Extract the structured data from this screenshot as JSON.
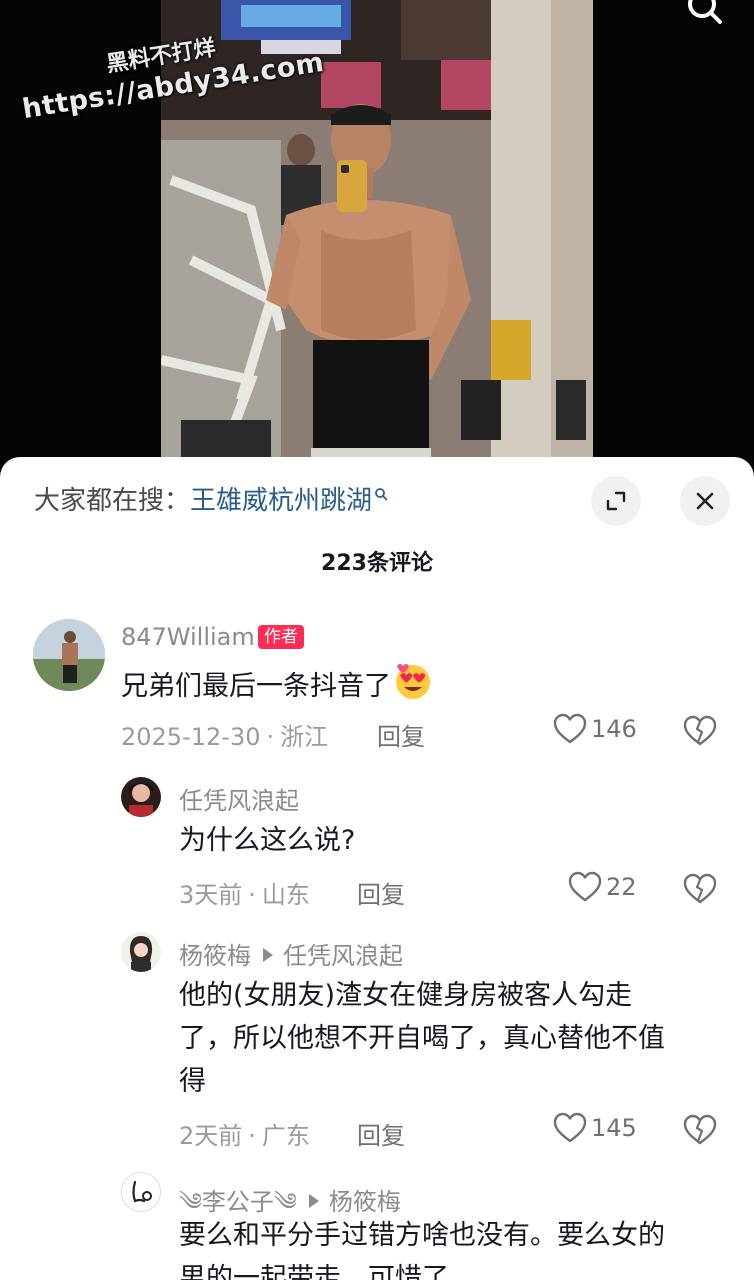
{
  "watermark": {
    "line1": "黑料不打烊",
    "line2": "https://abdy34.com"
  },
  "sheet": {
    "hot_search_prefix": "大家都在搜：",
    "hot_search_term": "王雄威杭州跳湖",
    "comment_count": "223条评论"
  },
  "comments": [
    {
      "author": "847William",
      "tag": "作者",
      "text": "兄弟们最后一条抖音了",
      "date": "2025-12-30",
      "location": "浙江",
      "reply_label": "回复",
      "likes": "146",
      "sep": "·",
      "emoji": "heart-eyes-emoji"
    },
    {
      "author": "任凭风浪起",
      "text": "为什么这么说?",
      "date": "3天前",
      "location": "山东",
      "reply_label": "回复",
      "likes": "22",
      "sep": "·"
    },
    {
      "author": "杨筱梅",
      "reply_to": "任凭风浪起",
      "text_lines": [
        "他的(女朋友)渣女在健身房被客人勾走",
        "了，所以他想不开自喝了，真心替他不值",
        "得"
      ],
      "date": "2天前",
      "location": "广东",
      "reply_label": "回复",
      "likes": "145",
      "sep": "·"
    },
    {
      "author": "༄李公子༄",
      "reply_to": "杨筱梅",
      "text_lines": [
        "要么和平分手过错方啥也没有。要么女的",
        "男的一起带走，可惜了"
      ]
    }
  ],
  "colors": {
    "author_tag_bg": "#fe2c55",
    "link_blue": "#2a5d8f",
    "text_dark": "#161823",
    "text_gray": "#8a8b91"
  }
}
